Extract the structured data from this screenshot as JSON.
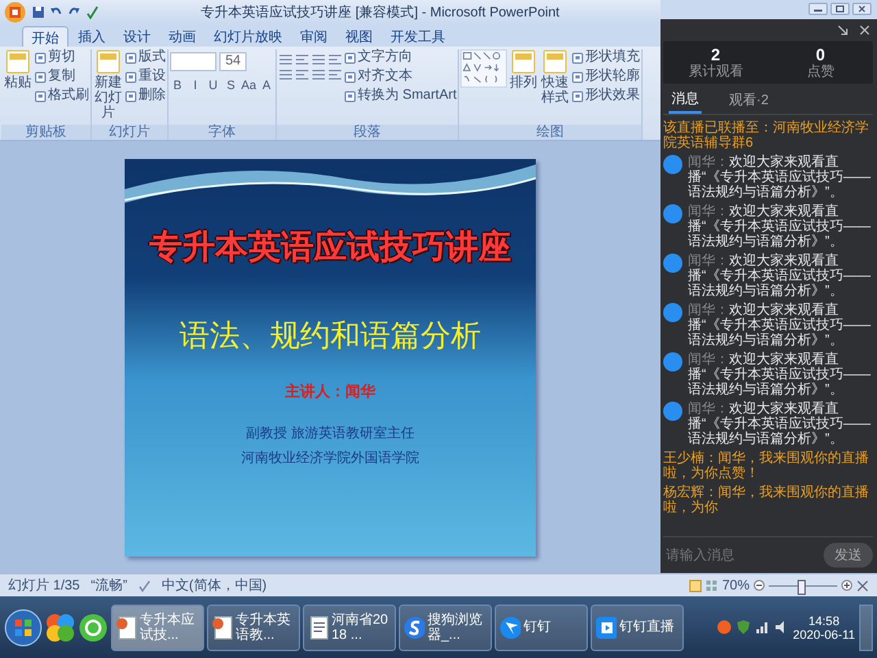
{
  "window": {
    "title": "专升本英语应试技巧讲座 [兼容模式] - Microsoft PowerPoint"
  },
  "ribbon_tabs": [
    {
      "label": "开始",
      "selected": true
    },
    {
      "label": "插入",
      "selected": false
    },
    {
      "label": "设计",
      "selected": false
    },
    {
      "label": "动画",
      "selected": false
    },
    {
      "label": "幻灯片放映",
      "selected": false
    },
    {
      "label": "审阅",
      "selected": false
    },
    {
      "label": "视图",
      "selected": false
    },
    {
      "label": "开发工具",
      "selected": false
    }
  ],
  "ribbon_groups": [
    {
      "kind": "buttons",
      "label": "剪贴板",
      "buttons": [
        {
          "kind": "large",
          "label": "粘贴"
        },
        {
          "kind": "small",
          "label": "剪切"
        },
        {
          "kind": "small",
          "label": "复制"
        },
        {
          "kind": "small",
          "label": "格式刷"
        }
      ]
    },
    {
      "kind": "buttons",
      "label": "幻灯片",
      "buttons": [
        {
          "kind": "large",
          "label": "新建幻灯片"
        },
        {
          "kind": "small",
          "label": "版式"
        },
        {
          "kind": "small",
          "label": "重设"
        },
        {
          "kind": "small",
          "label": "删除"
        }
      ]
    },
    {
      "kind": "font",
      "label": "字体",
      "font_size": "54",
      "format_keys": [
        "B",
        "I",
        "U",
        "S",
        "Aa",
        "A"
      ]
    },
    {
      "kind": "paragraph",
      "label": "段落",
      "buttons": [
        {
          "kind": "small",
          "label": "文字方向"
        },
        {
          "kind": "small",
          "label": "对齐文本"
        },
        {
          "kind": "small",
          "label": "转换为 SmartArt"
        }
      ]
    },
    {
      "kind": "drawing",
      "label": "绘图",
      "buttons": [
        {
          "kind": "large",
          "label": "排列"
        },
        {
          "kind": "large",
          "label": "快速样式"
        },
        {
          "kind": "small",
          "label": "形状填充"
        },
        {
          "kind": "small",
          "label": "形状轮廓"
        },
        {
          "kind": "small",
          "label": "形状效果"
        }
      ]
    }
  ],
  "slide": {
    "title": "专升本英语应试技巧讲座",
    "subtitle": "语法、规约和语篇分析",
    "presenter": "主讲人：闻华",
    "affiliation": [
      "副教授  旅游英语教研室主任",
      "河南牧业经济学院外国语学院"
    ]
  },
  "live_panel": {
    "stats": [
      {
        "value": "2",
        "label": "累计观看"
      },
      {
        "value": "0",
        "label": "点赞"
      }
    ],
    "tabs": [
      {
        "label": "消息",
        "selected": true
      },
      {
        "label": "观看·2",
        "selected": false
      }
    ],
    "messages": [
      {
        "kind": "notice",
        "text": "该直播已联播至：河南牧业经济学院英语辅导群6"
      },
      {
        "kind": "system",
        "sender": "闻华：",
        "text": "欢迎大家来观看直播“《专升本英语应试技巧——语法规约与语篇分析》”。"
      },
      {
        "kind": "system",
        "sender": "闻华：",
        "text": "欢迎大家来观看直播“《专升本英语应试技巧——语法规约与语篇分析》”。"
      },
      {
        "kind": "system",
        "sender": "闻华：",
        "text": "欢迎大家来观看直播“《专升本英语应试技巧——语法规约与语篇分析》”。"
      },
      {
        "kind": "system",
        "sender": "闻华：",
        "text": "欢迎大家来观看直播“《专升本英语应试技巧——语法规约与语篇分析》”。"
      },
      {
        "kind": "system",
        "sender": "闻华：",
        "text": "欢迎大家来观看直播“《专升本英语应试技巧——语法规约与语篇分析》”。"
      },
      {
        "kind": "system",
        "sender": "闻华：",
        "text": "欢迎大家来观看直播“《专升本英语应试技巧——语法规约与语篇分析》”。"
      },
      {
        "kind": "viewer",
        "text": "王少楠：闻华，我来围观你的直播啦，为你点赞！"
      },
      {
        "kind": "viewer",
        "text": "杨宏辉：闻华，我来围观你的直播啦，为你"
      }
    ],
    "input": {
      "placeholder": "请输入消息"
    },
    "send_button": "发送"
  },
  "status_bar": {
    "items": [
      "幻灯片 1/35",
      "“流畅”",
      "中文(简体，中国)"
    ],
    "zoom": "70%",
    "zoom_slider": {
      "level": 0.45
    }
  },
  "taskbar": {
    "tasks": [
      {
        "label": "专升本应试技...",
        "selected": true
      },
      {
        "label": "专升本英语教...",
        "selected": false
      },
      {
        "label": "河南省2018 ...",
        "selected": false
      },
      {
        "label": "搜狗浏览器_...",
        "selected": false
      },
      {
        "label": "钉钉",
        "selected": false
      },
      {
        "label": "钉钉直播",
        "selected": false
      }
    ],
    "time": "14:58",
    "date": "2020-06-11"
  }
}
